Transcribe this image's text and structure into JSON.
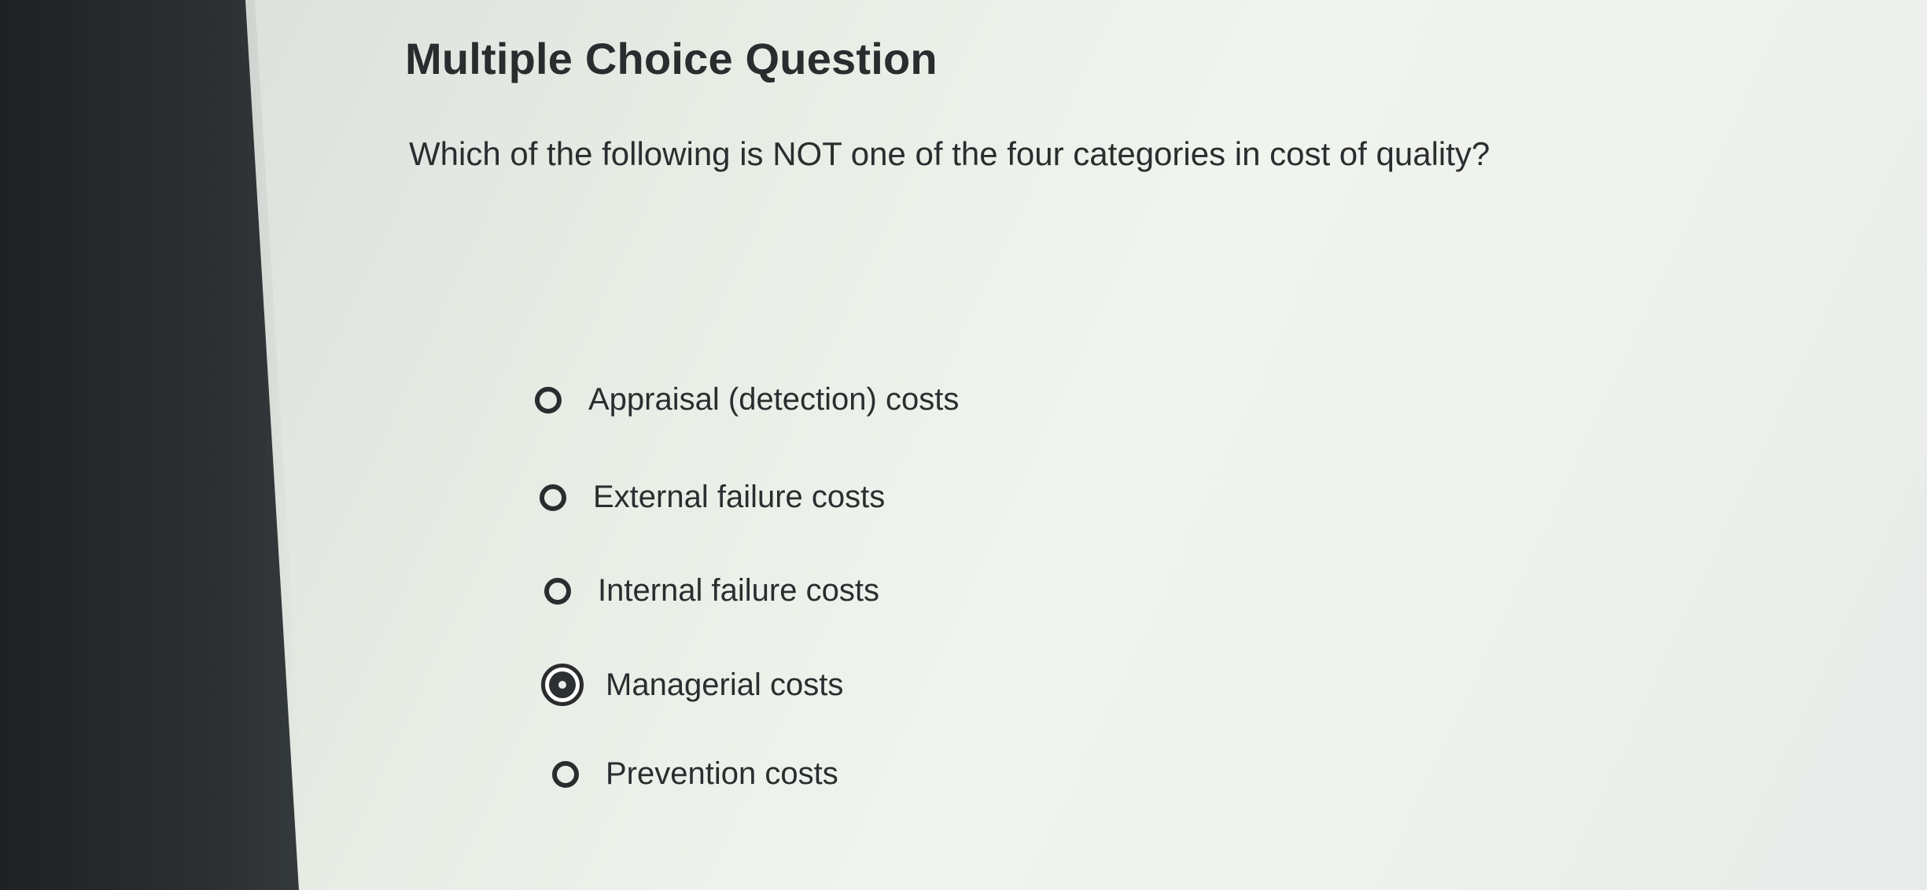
{
  "question": {
    "heading": "Multiple Choice Question",
    "prompt": "Which of the following is NOT one of the four categories in cost of quality?",
    "options": [
      {
        "label": "Appraisal (detection) costs",
        "selected": false
      },
      {
        "label": "External failure costs",
        "selected": false
      },
      {
        "label": "Internal failure costs",
        "selected": false
      },
      {
        "label": "Managerial costs",
        "selected": true
      },
      {
        "label": "Prevention costs",
        "selected": false
      }
    ]
  },
  "colors": {
    "text": "#2b2d2f",
    "background": "#eef1ec",
    "bezel": "#2b2f31"
  },
  "icons": {
    "unselected": "radio-unselected-icon",
    "selected": "radio-selected-icon"
  }
}
